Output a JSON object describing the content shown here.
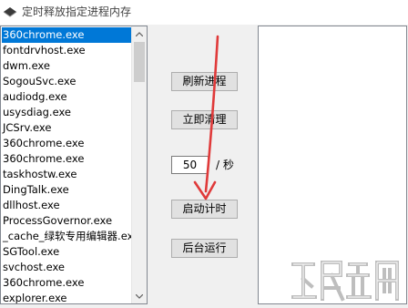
{
  "window": {
    "title": "定时释放指定进程内存"
  },
  "process_list": {
    "selected_index": 0,
    "items": [
      "360chrome.exe",
      "fontdrvhost.exe",
      "dwm.exe",
      "SogouSvc.exe",
      "audiodg.exe",
      "usysdiag.exe",
      "JCSrv.exe",
      "360chrome.exe",
      "360chrome.exe",
      "taskhostw.exe",
      "DingTalk.exe",
      "dllhost.exe",
      "ProcessGovernor.exe",
      "_cache_绿软专用编辑器.ex",
      "SGTool.exe",
      "svchost.exe",
      "360chrome.exe",
      "explorer.exe"
    ]
  },
  "buttons": {
    "refresh": "刷新进程",
    "clean_now": "立即清理",
    "start_timer": "启动计时",
    "run_background": "后台运行"
  },
  "timer": {
    "interval_value": "50",
    "unit_label": "/ 秒"
  },
  "colors": {
    "selection": "#0078d7",
    "annotation_arrow": "#e03a3a",
    "window_bg": "#f0f0f0"
  },
  "icons": {
    "app": "app-logo-icon",
    "scroll_up": "chevron-up-icon",
    "scroll_down": "chevron-down-icon",
    "annotation": "red-arrow-annotation",
    "watermark": "download-site-watermark"
  }
}
